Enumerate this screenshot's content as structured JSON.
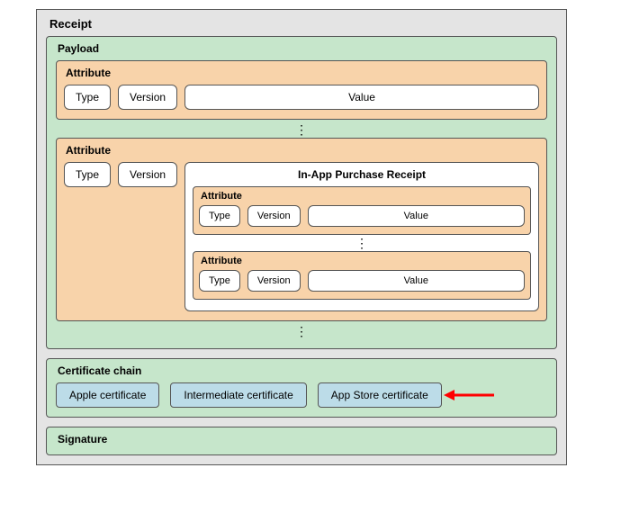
{
  "receipt": {
    "title": "Receipt",
    "payload": {
      "title": "Payload",
      "attribute1": {
        "title": "Attribute",
        "type": "Type",
        "version": "Version",
        "value": "Value"
      },
      "attribute2": {
        "title": "Attribute",
        "type": "Type",
        "version": "Version",
        "iap": {
          "title": "In-App Purchase Receipt",
          "attr1": {
            "title": "Attribute",
            "type": "Type",
            "version": "Version",
            "value": "Value"
          },
          "attr2": {
            "title": "Attribute",
            "type": "Type",
            "version": "Version",
            "value": "Value"
          }
        }
      }
    },
    "cert_chain": {
      "title": "Certificate chain",
      "apple": "Apple certificate",
      "intermediate": "Intermediate certificate",
      "appstore": "App Store certificate"
    },
    "signature": {
      "title": "Signature"
    }
  },
  "ellipsis": "⋮",
  "colors": {
    "receipt_bg": "#e4e4e4",
    "green": "#c6e6cb",
    "orange": "#f8d3aa",
    "blue": "#bcdce8",
    "arrow": "#ff0000"
  }
}
